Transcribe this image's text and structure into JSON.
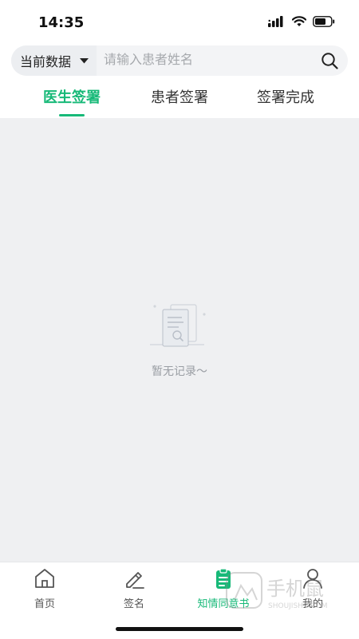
{
  "status_bar": {
    "time": "14:35"
  },
  "search": {
    "filter_label": "当前数据",
    "placeholder": "请输入患者姓名",
    "value": ""
  },
  "tabs": [
    {
      "label": "医生签署",
      "active": true
    },
    {
      "label": "患者签署",
      "active": false
    },
    {
      "label": "签署完成",
      "active": false
    }
  ],
  "empty_state": {
    "text": "暂无记录～"
  },
  "tabbar": [
    {
      "label": "首页",
      "icon": "home-icon",
      "active": false
    },
    {
      "label": "签名",
      "icon": "edit-icon",
      "active": false
    },
    {
      "label": "知情同意书",
      "icon": "clipboard-icon",
      "active": true
    },
    {
      "label": "我的",
      "icon": "user-icon",
      "active": false
    }
  ],
  "watermark": {
    "text": "手机鼠",
    "subtext": "SHOUJISHU.COM"
  },
  "colors": {
    "accent": "#17b978",
    "background": "#eff0f2"
  }
}
